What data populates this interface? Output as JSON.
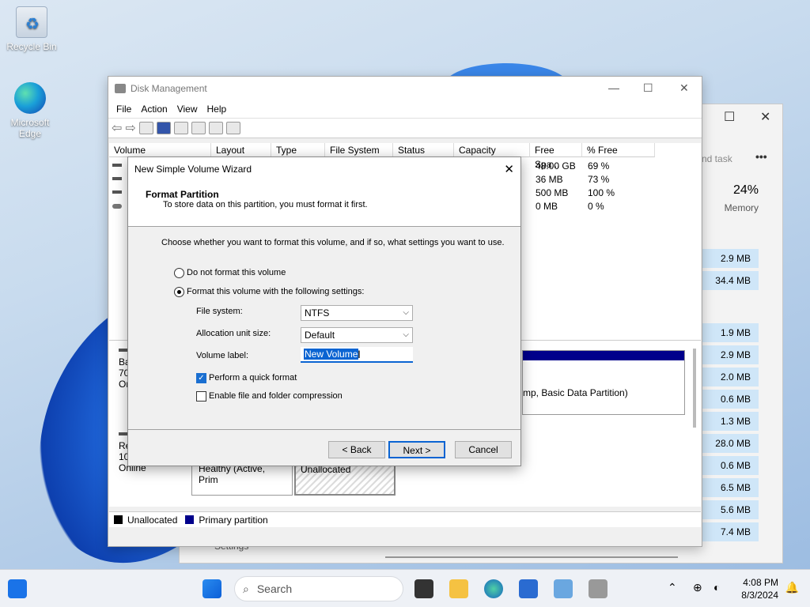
{
  "desktop": {
    "icons": [
      {
        "label": "Recycle Bin"
      },
      {
        "label": "Microsoft Edge"
      }
    ]
  },
  "task_manager": {
    "toolbar_text": "nd task",
    "more_label": "•••",
    "memory_percent": "24%",
    "memory_label": "Memory",
    "memory_values": [
      "2.9 MB",
      "34.4 MB",
      "1.9 MB",
      "2.9 MB",
      "2.0 MB",
      "0.6 MB",
      "1.3 MB",
      "28.0 MB",
      "0.6 MB",
      "6.5 MB",
      "5.6 MB",
      "7.4 MB"
    ],
    "settings_label": "Settings"
  },
  "disk_mgmt": {
    "title": "Disk Management",
    "menu": [
      "File",
      "Action",
      "View",
      "Help"
    ],
    "columns": [
      "Volume",
      "Layout",
      "Type",
      "File System",
      "Status",
      "Capacity",
      "Free Spa...",
      "% Free"
    ],
    "rows": [
      {
        "free": "48.00 GB",
        "pct": "69 %"
      },
      {
        "free": "36 MB",
        "pct": "73 %"
      },
      {
        "free": "500 MB",
        "pct": "100 %"
      },
      {
        "free": "0 MB",
        "pct": "0 %"
      }
    ],
    "disk0": {
      "line1": "Bas",
      "line2": "70.",
      "line3": "Onl",
      "partition_text": "mp, Basic Data Partition)"
    },
    "disk1": {
      "line1": "Re",
      "line2": "10(",
      "line3": "Online",
      "healthy": "Healthy (Active, Prim",
      "unalloc": "Unallocated"
    },
    "legend": {
      "unallocated": "Unallocated",
      "primary": "Primary partition"
    }
  },
  "wizard": {
    "title": "New Simple Volume Wizard",
    "heading": "Format Partition",
    "subheading": "To store data on this partition, you must format it first.",
    "instruction": "Choose whether you want to format this volume, and if so, what settings you want to use.",
    "radio_no_format": "Do not format this volume",
    "radio_format": "Format this volume with the following settings:",
    "fs_label": "File system:",
    "fs_value": "NTFS",
    "alloc_label": "Allocation unit size:",
    "alloc_value": "Default",
    "vol_label": "Volume label:",
    "vol_value": "New Volume",
    "quick_format": "Perform a quick format",
    "compression": "Enable file and folder compression",
    "back": "< Back",
    "next": "Next >",
    "cancel": "Cancel"
  },
  "taskbar": {
    "search_placeholder": "Search",
    "time": "4:08 PM",
    "date": "8/3/2024"
  },
  "colors": {
    "primary_partition": "#00008b",
    "selection": "#0a64d2",
    "task_highlight": "#cfe6f8"
  }
}
